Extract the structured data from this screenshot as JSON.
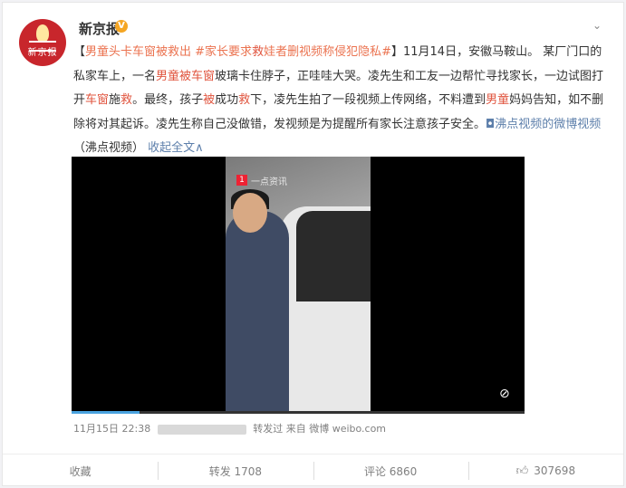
{
  "account": {
    "name": "新京报",
    "verified_icon": "verified-badge-icon",
    "avatar_text": "新京报"
  },
  "post": {
    "segments": [
      {
        "t": "【",
        "c": ""
      },
      {
        "t": "男童头卡车窗被救出 ",
        "c": "link"
      },
      {
        "t": "#家长要求",
        "c": "link"
      },
      {
        "t": "救",
        "c": "red"
      },
      {
        "t": "娃者删视频称侵犯隐私#",
        "c": "link"
      },
      {
        "t": "】11月14日，安徽马鞍山。 某厂门口的私家车上，一名",
        "c": ""
      },
      {
        "t": "男童被车窗",
        "c": "red"
      },
      {
        "t": "玻璃卡住脖子，正哇哇大哭。凌先生和工友一边帮忙寻找家长，一边试图打开",
        "c": ""
      },
      {
        "t": "车窗",
        "c": "red"
      },
      {
        "t": "施",
        "c": ""
      },
      {
        "t": "救",
        "c": "red"
      },
      {
        "t": "。最终，孩子",
        "c": ""
      },
      {
        "t": "被",
        "c": "red"
      },
      {
        "t": "成功",
        "c": ""
      },
      {
        "t": "救",
        "c": "red"
      },
      {
        "t": "下，凌先生拍了一段视频上传网络，不料遭到",
        "c": ""
      },
      {
        "t": "男童",
        "c": "red"
      },
      {
        "t": "妈妈告知，如不删除将对其起诉。凌先生称自己没做错，发视频是为提醒所有家长注意孩子安全。",
        "c": ""
      },
      {
        "t": "◘沸点视频的微博视频",
        "c": "blue"
      },
      {
        "t": "（沸点视频） ",
        "c": ""
      },
      {
        "t": "收起全文∧",
        "c": "blue"
      }
    ]
  },
  "video": {
    "watermark": "一点资讯",
    "progress": 0.15,
    "mute_icon": "mute-icon"
  },
  "meta": {
    "time": "11月15日 22:38",
    "via": "转发过",
    "source": "来自 微博 weibo.com"
  },
  "actions": {
    "collect": "收藏",
    "repost": "转发 1708",
    "comment": "评论 6860",
    "like": "307698"
  }
}
